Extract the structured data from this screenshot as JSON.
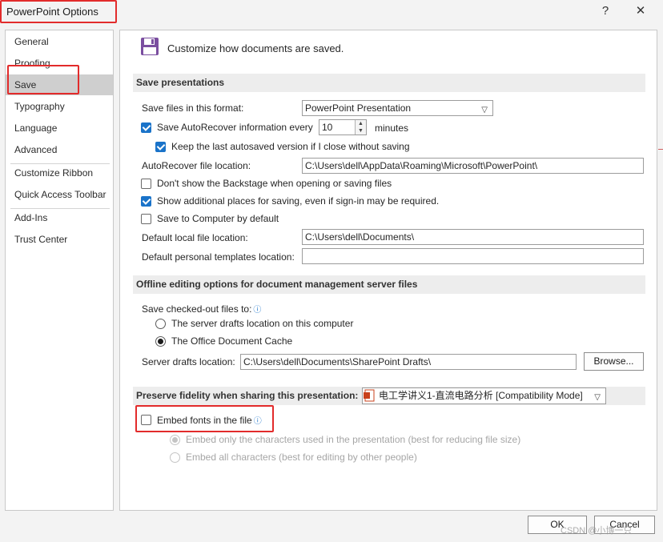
{
  "window": {
    "title": "PowerPoint Options",
    "help_icon": "?",
    "close_icon": "✕"
  },
  "sidebar": {
    "items": [
      {
        "label": "General"
      },
      {
        "label": "Proofing"
      },
      {
        "label": "Save"
      },
      {
        "label": "Typography"
      },
      {
        "label": "Language"
      },
      {
        "label": "Advanced"
      },
      {
        "label": "Customize Ribbon"
      },
      {
        "label": "Quick Access Toolbar"
      },
      {
        "label": "Add-Ins"
      },
      {
        "label": "Trust Center"
      }
    ],
    "active": "Save"
  },
  "main": {
    "header": "Customize how documents are saved.",
    "save_section": {
      "title": "Save presentations",
      "format_label": "Save files in this format:",
      "format_value": "PowerPoint Presentation",
      "autorecover_label": "Save AutoRecover information every",
      "autorecover_checked": true,
      "autorecover_minutes": "10",
      "minutes_label": "minutes",
      "keep_last_label": "Keep the last autosaved version if I close without saving",
      "keep_last_checked": true,
      "autorecover_location_label": "AutoRecover file location:",
      "autorecover_location_value": "C:\\Users\\dell\\AppData\\Roaming\\Microsoft\\PowerPoint\\",
      "backstage_label": "Don't show the Backstage when opening or saving files",
      "backstage_checked": false,
      "additional_places_label": "Show additional places for saving, even if sign-in may be required.",
      "additional_places_checked": true,
      "save_to_computer_label": "Save to Computer by default",
      "save_to_computer_checked": false,
      "default_local_label": "Default local file location:",
      "default_local_value": "C:\\Users\\dell\\Documents\\",
      "default_templates_label": "Default personal templates location:",
      "default_templates_value": ""
    },
    "offline_section": {
      "title": "Offline editing options for document management server files",
      "save_checked_out_label": "Save checked-out files to:",
      "server_drafts_option": "The server drafts location on this computer",
      "office_cache_option": "The Office Document Cache",
      "selected": "The Office Document Cache",
      "server_drafts_label": "Server drafts location:",
      "server_drafts_value": "C:\\Users\\dell\\Documents\\SharePoint Drafts\\",
      "browse_label": "Browse..."
    },
    "fidelity_section": {
      "title": "Preserve fidelity when sharing this presentation:",
      "presentation_value": "电工学讲义1-直流电路分析 [Compatibility Mode]",
      "embed_fonts_label": "Embed fonts in the file",
      "embed_fonts_checked": false,
      "embed_only_label": "Embed only the characters used in the presentation (best for reducing file size)",
      "embed_all_label": "Embed all characters (best for editing by other people)"
    }
  },
  "footer": {
    "ok_label": "OK",
    "cancel_label": "Cancel"
  },
  "watermark": "CSDN @小博一只",
  "colors": {
    "accent": "#1a73c9",
    "highlight": "#e22b2b",
    "active_nav": "#cfcfcf"
  },
  "icons": {
    "save_disk": "floppy-disk-icon",
    "info": "info-icon",
    "ppt_file": "powerpoint-file-icon"
  }
}
